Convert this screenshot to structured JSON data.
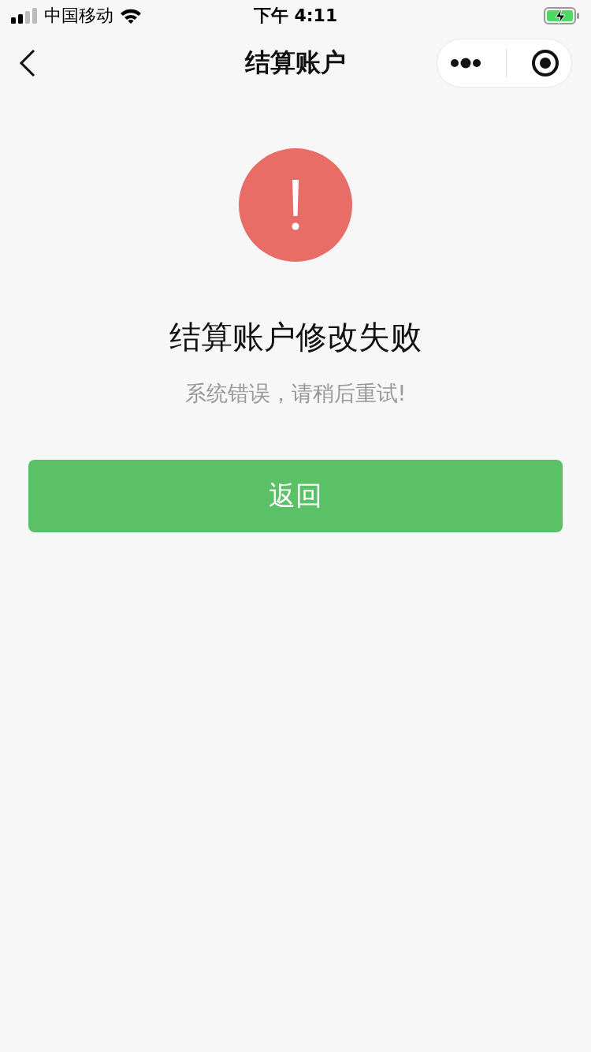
{
  "status_bar": {
    "carrier": "中国移动",
    "time": "下午 4:11"
  },
  "nav_bar": {
    "title": "结算账户"
  },
  "result": {
    "title": "结算账户修改失败",
    "message": "系统错误，请稍后重试!"
  },
  "buttons": [
    {
      "label": "返回",
      "kind": "primary"
    }
  ]
}
